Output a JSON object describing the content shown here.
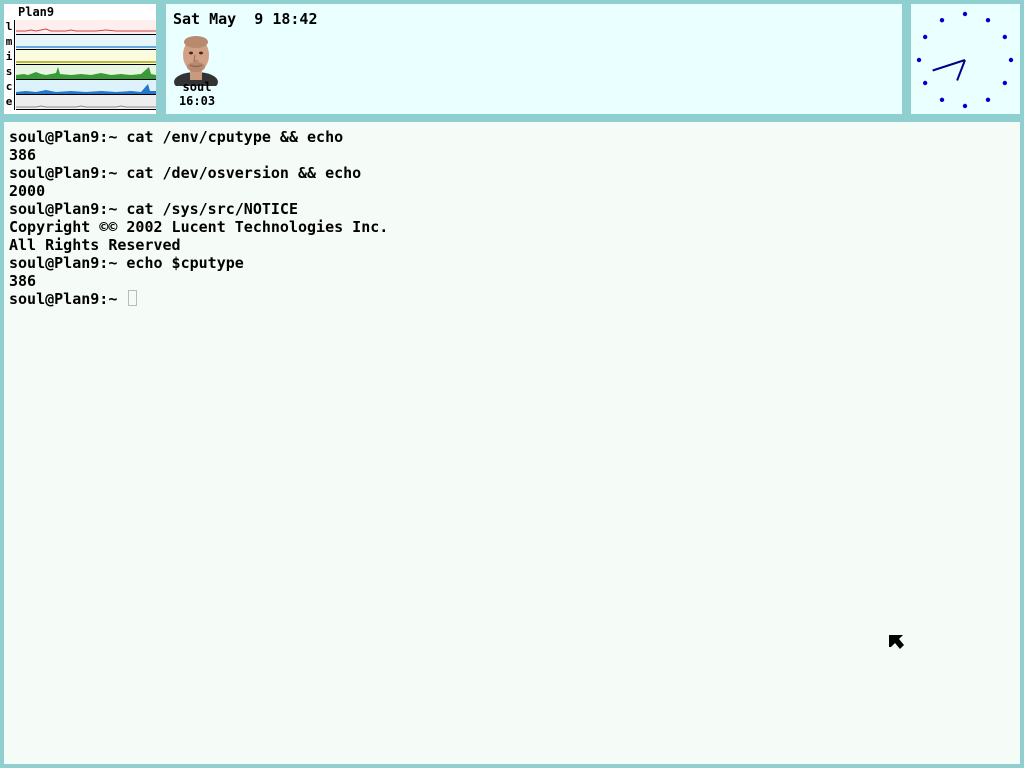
{
  "stats": {
    "title": "Plan9",
    "rows": [
      {
        "label": "l",
        "bg": "#ffeeee",
        "line": "#cc4444"
      },
      {
        "label": "m",
        "bg": "#e6f6fb",
        "line": "#66aadd"
      },
      {
        "label": "i",
        "bg": "#fbfbde",
        "line": "#bbbb44"
      },
      {
        "label": "s",
        "bg": "#e6f6e0",
        "line": "#3a9a3a"
      },
      {
        "label": "c",
        "bg": "#ddf2fb",
        "line": "#2277cc"
      },
      {
        "label": "e",
        "bg": "#eeeeee",
        "line": "#888888"
      }
    ]
  },
  "faces": {
    "date": "Sat May  9 18:42",
    "user": "soul",
    "time": "16:03"
  },
  "clock": {
    "hour": 6,
    "minute": 42,
    "dot_color": "#0000cc",
    "hand_color": "#000088"
  },
  "terminal": {
    "lines": [
      "soul@Plan9:~ cat /env/cputype && echo",
      "386",
      "soul@Plan9:~ cat /dev/osversion && echo",
      "2000",
      "soul@Plan9:~ cat /sys/src/NOTICE",
      "Copyright ©© 2002 Lucent Technologies Inc.",
      "All Rights Reserved",
      "soul@Plan9:~ echo $cputype",
      "386"
    ],
    "prompt": "soul@Plan9:~ "
  }
}
